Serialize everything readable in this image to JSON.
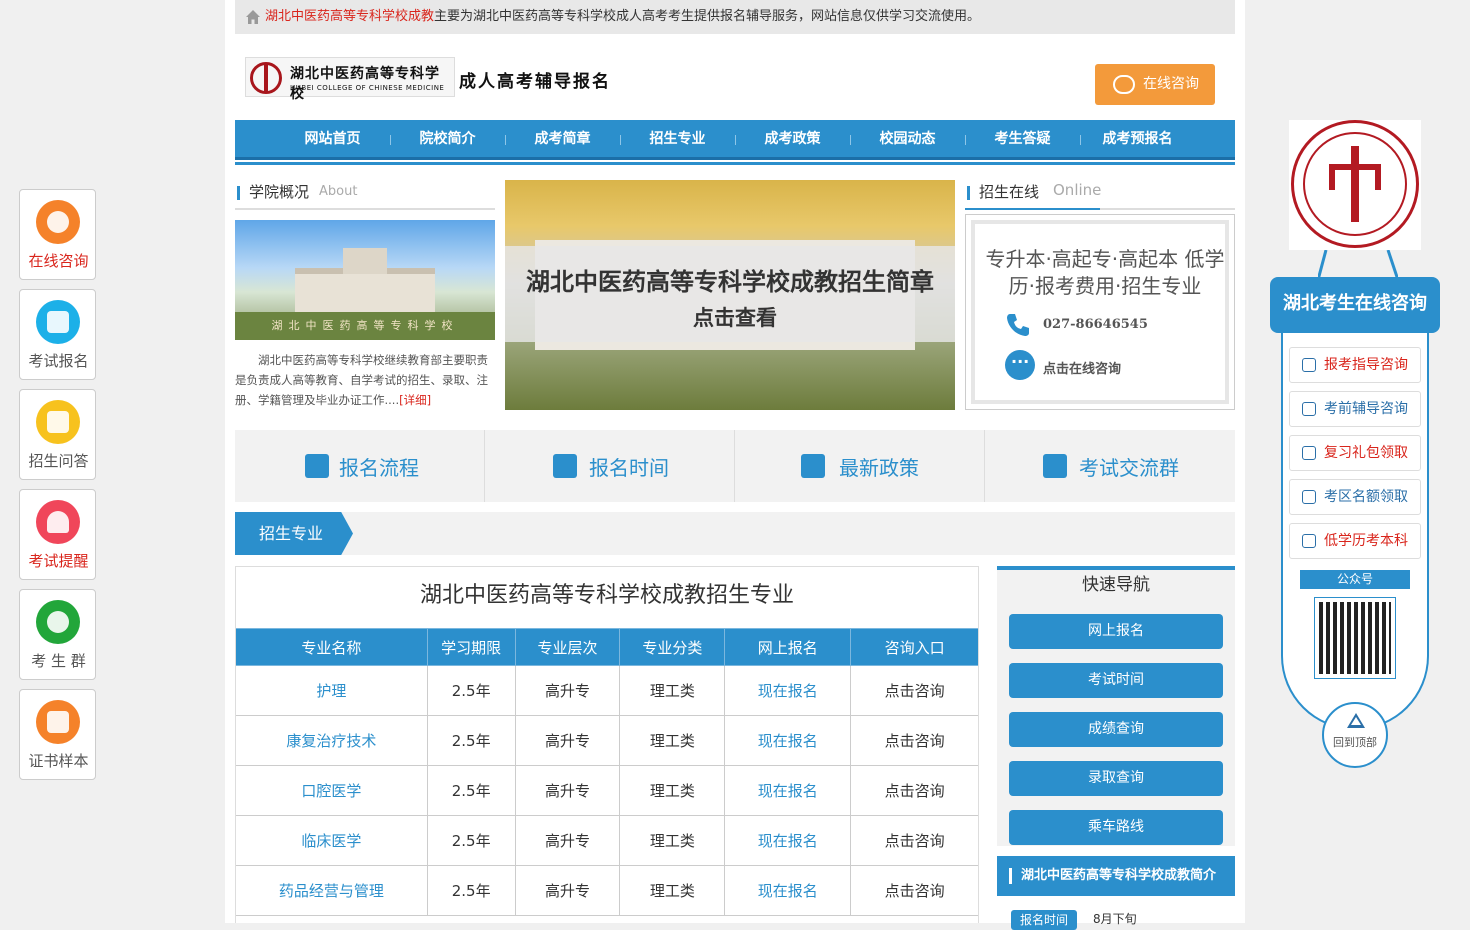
{
  "notice": {
    "school_link": "湖北中医药高等专科学校成教",
    "text": "主要为湖北中医药高等专科学校成人高考考生提供报名辅导服务，网站信息仅供学习交流使用。"
  },
  "header": {
    "school_cn": "湖北中医药高等专科学校",
    "school_en": "HUBEI COLLEGE OF CHINESE MEDICINE",
    "slogan": "成人高考辅导报名",
    "consult_label": "在线咨询"
  },
  "nav": {
    "items": [
      "网站首页",
      "院校简介",
      "成考简章",
      "招生专业",
      "成考政策",
      "校园动态",
      "考生答疑",
      "成考预报名"
    ]
  },
  "about": {
    "title": "学院概况",
    "title_en": "About",
    "banner": "湖北中医药高等专科学校",
    "text": "湖北中医药高等专科学校继续教育部主要职责是负责成人高等教育、自学考试的招生、录取、注册、学籍管理及毕业办证工作....",
    "more": "[详细]"
  },
  "slide": {
    "title": "湖北中医药高等专科学校成教招生简章",
    "sub": "点击查看"
  },
  "online": {
    "title": "招生在线",
    "title_en": "Online",
    "desc": "专升本·高起专·高起本 低学历·报考费用·招生专业",
    "phone": "027-86646545",
    "chat": "点击在线咨询"
  },
  "quick": {
    "items": [
      "报名流程",
      "报名时间",
      "最新政策",
      "考试交流群"
    ]
  },
  "majors_tab": "招生专业",
  "table": {
    "title": "湖北中医药高等专科学校成教招生专业",
    "headers": [
      "专业名称",
      "学习期限",
      "专业层次",
      "专业分类",
      "网上报名",
      "咨询入口"
    ],
    "rows": [
      [
        "护理",
        "2.5年",
        "高升专",
        "理工类",
        "现在报名",
        "点击咨询"
      ],
      [
        "康复治疗技术",
        "2.5年",
        "高升专",
        "理工类",
        "现在报名",
        "点击咨询"
      ],
      [
        "口腔医学",
        "2.5年",
        "高升专",
        "理工类",
        "现在报名",
        "点击咨询"
      ],
      [
        "临床医学",
        "2.5年",
        "高升专",
        "理工类",
        "现在报名",
        "点击咨询"
      ],
      [
        "药品经营与管理",
        "2.5年",
        "高升专",
        "理工类",
        "现在报名",
        "点击咨询"
      ]
    ]
  },
  "fast_nav": {
    "title": "快速导航",
    "items": [
      "网上报名",
      "考试时间",
      "成绩查询",
      "录取查询",
      "乘车路线"
    ]
  },
  "intro": {
    "title": "湖北中医药高等专科学校成教简介",
    "tag": "报名时间",
    "value": "8月下旬"
  },
  "left_float": {
    "items": [
      "在线咨询",
      "考试报名",
      "招生问答",
      "考试提醒",
      "考 生 群",
      "证书样本"
    ]
  },
  "right_float": {
    "head": "湖北考生在线咨询",
    "items": [
      "报考指导咨询",
      "考前辅导咨询",
      "复习礼包领取",
      "考区名额领取",
      "低学历考本科"
    ],
    "qr_label": "公众号",
    "top_label": "回到顶部"
  }
}
